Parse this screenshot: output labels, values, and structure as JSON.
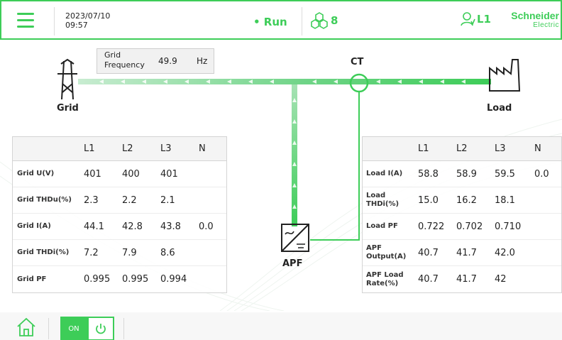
{
  "header": {
    "date": "2023/07/10",
    "time": "09:57",
    "status": "• Run",
    "module_count": "8",
    "phase_user": "L1",
    "brand_line1": "Schneider",
    "brand_line2": "Electric",
    "accent_color": "#3dcd58"
  },
  "grid_frequency": {
    "label_line1": "Grid",
    "label_line2": "Frequency",
    "value": "49.9",
    "unit": "Hz"
  },
  "nodes": {
    "grid": "Grid",
    "load": "Load",
    "ct": "CT",
    "apf": "APF"
  },
  "grid_table": {
    "columns": [
      "L1",
      "L2",
      "L3",
      "N"
    ],
    "rows": [
      {
        "name": "Grid U(V)",
        "l1": "401",
        "l2": "400",
        "l3": "401",
        "n": ""
      },
      {
        "name": "Grid THDu(%)",
        "l1": "2.3",
        "l2": "2.2",
        "l3": "2.1",
        "n": ""
      },
      {
        "name": "Grid I(A)",
        "l1": "44.1",
        "l2": "42.8",
        "l3": "43.8",
        "n": "0.0"
      },
      {
        "name": "Grid THDi(%)",
        "l1": "7.2",
        "l2": "7.9",
        "l3": "8.6",
        "n": ""
      },
      {
        "name": "Grid PF",
        "l1": "0.995",
        "l2": "0.995",
        "l3": "0.994",
        "n": ""
      }
    ]
  },
  "load_table": {
    "columns": [
      "L1",
      "L2",
      "L3",
      "N"
    ],
    "rows": [
      {
        "name1": "Load I(A)",
        "name2": "",
        "l1": "58.8",
        "l2": "58.9",
        "l3": "59.5",
        "n": "0.0"
      },
      {
        "name1": "Load",
        "name2": "THDi(%)",
        "l1": "15.0",
        "l2": "16.2",
        "l3": "18.1",
        "n": ""
      },
      {
        "name1": "Load PF",
        "name2": "",
        "l1": "0.722",
        "l2": "0.702",
        "l3": "0.710",
        "n": ""
      },
      {
        "name1": "APF",
        "name2": "Output(A)",
        "l1": "40.7",
        "l2": "41.7",
        "l3": "42.0",
        "n": ""
      },
      {
        "name1": "APF Load",
        "name2": "Rate(%)",
        "l1": "40.7",
        "l2": "41.7",
        "l3": "42",
        "n": ""
      }
    ]
  },
  "footer": {
    "toggle_label": "ON"
  }
}
